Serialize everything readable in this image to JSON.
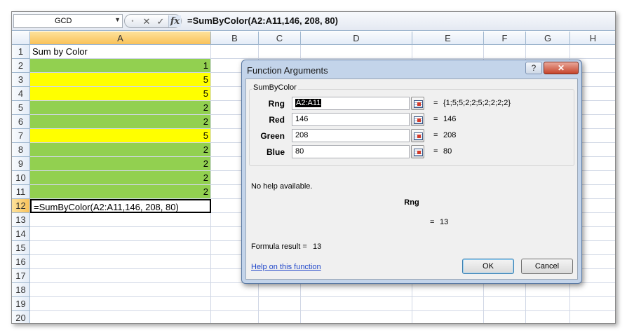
{
  "formula_bar": {
    "name_box": "GCD",
    "cancel_icon": "✕",
    "enter_icon": "✓",
    "fx_label": "fx",
    "formula": "=SumByColor(A2:A11,146, 208, 80)"
  },
  "columns": [
    "A",
    "B",
    "C",
    "D",
    "E",
    "F",
    "G",
    "H"
  ],
  "rows": [
    {
      "n": "1",
      "a": "Sum by Color",
      "fill": ""
    },
    {
      "n": "2",
      "a": "1",
      "fill": "green"
    },
    {
      "n": "3",
      "a": "5",
      "fill": "yellow"
    },
    {
      "n": "4",
      "a": "5",
      "fill": "yellow"
    },
    {
      "n": "5",
      "a": "2",
      "fill": "green"
    },
    {
      "n": "6",
      "a": "2",
      "fill": "green"
    },
    {
      "n": "7",
      "a": "5",
      "fill": "yellow"
    },
    {
      "n": "8",
      "a": "2",
      "fill": "green"
    },
    {
      "n": "9",
      "a": "2",
      "fill": "green"
    },
    {
      "n": "10",
      "a": "2",
      "fill": "green"
    },
    {
      "n": "11",
      "a": "2",
      "fill": "green"
    },
    {
      "n": "12",
      "a": "=SumByColor(A2:A11,146, 208, 80)",
      "fill": "active"
    },
    {
      "n": "13",
      "a": "",
      "fill": ""
    },
    {
      "n": "14",
      "a": "",
      "fill": ""
    },
    {
      "n": "15",
      "a": "",
      "fill": ""
    },
    {
      "n": "16",
      "a": "",
      "fill": ""
    },
    {
      "n": "17",
      "a": "",
      "fill": ""
    },
    {
      "n": "18",
      "a": "",
      "fill": ""
    },
    {
      "n": "19",
      "a": "",
      "fill": ""
    },
    {
      "n": "20",
      "a": "",
      "fill": ""
    }
  ],
  "colors": {
    "green": "#92d050",
    "yellow": "#ffff00"
  },
  "dialog": {
    "title": "Function Arguments",
    "help_button": "?",
    "close_button": "✕",
    "function_name": "SumByColor",
    "args": [
      {
        "label": "Rng",
        "value": "A2:A11",
        "result": "{1;5;5;2;2;5;2;2;2;2}"
      },
      {
        "label": "Red",
        "value": "146",
        "result": "146"
      },
      {
        "label": "Green",
        "value": "208",
        "result": "208"
      },
      {
        "label": "Blue",
        "value": "80",
        "result": "80"
      }
    ],
    "equals": "=",
    "total_result": "13",
    "no_help": "No help available.",
    "arg_description": "Rng",
    "formula_result_label": "Formula result =",
    "formula_result_value": "13",
    "help_link": "Help on this function",
    "ok_label": "OK",
    "cancel_label": "Cancel"
  }
}
